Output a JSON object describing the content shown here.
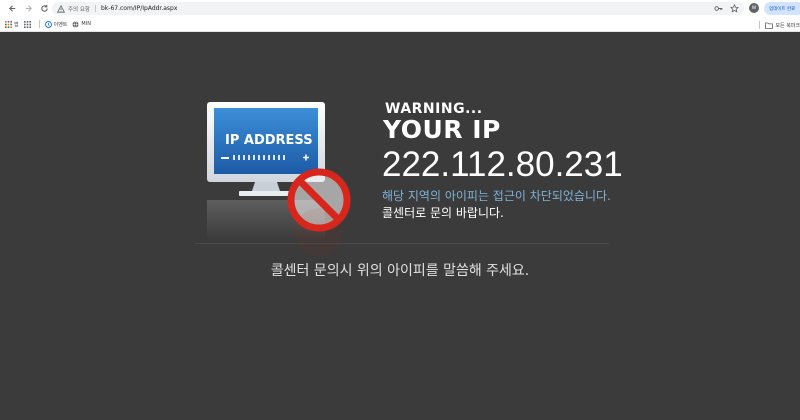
{
  "browser": {
    "url": "bk-67.com/IP/IpAddr.aspx",
    "security_label": "주의 요함",
    "avatar_text": "W",
    "update_label": "업데이트 완료",
    "icons": {
      "back": "back-arrow-icon",
      "forward": "forward-arrow-icon",
      "reload": "reload-icon",
      "warning": "not-secure-warning-icon",
      "key": "password-key-icon",
      "star": "bookmark-star-icon"
    }
  },
  "bookmarks_bar": {
    "items": [
      {
        "label": "앱",
        "icon": "apps-grid-icon"
      },
      {
        "label": "",
        "icon": "google-apps-icon"
      },
      {
        "label": "이벤트",
        "icon": "event-icon"
      },
      {
        "label": "MIN",
        "icon": "globe-icon"
      }
    ],
    "all_bookmarks_label": "모든 북마크"
  },
  "page": {
    "illustration_text": "IP ADDRESS",
    "warning": "WARNING...",
    "your_ip": "YOUR IP",
    "ip": "222.112.80.231",
    "blocked_message": "해당 지역의 아이피는 접근이 차단되었습니다.",
    "callcenter_message": "콜센터로 문의 바랍니다.",
    "notice": "콜센터 문의시 위의 아이피를 말씀해 주세요.",
    "colors": {
      "background": "#3b3b3b",
      "accent_text": "#7fb1d6",
      "prohibit_red": "#d8261d"
    }
  }
}
